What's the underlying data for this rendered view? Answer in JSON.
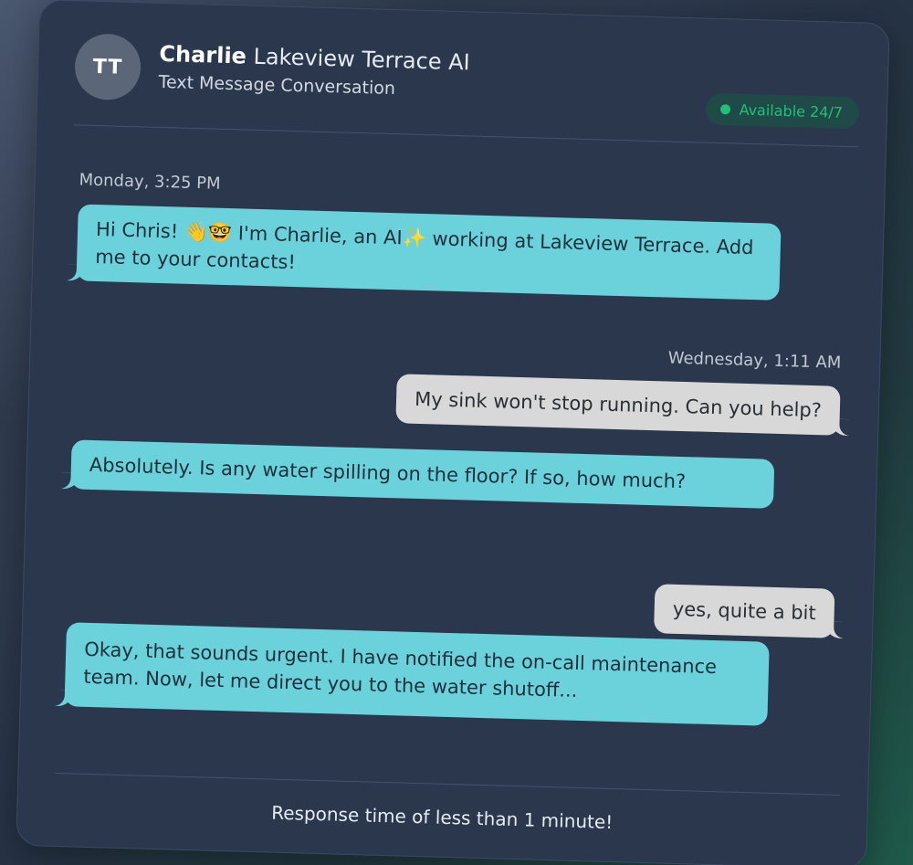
{
  "header": {
    "avatar_initials": "TT",
    "name": "Charlie",
    "title_rest": "Lakeview Terrace AI",
    "subtitle": "Text Message Conversation",
    "availability": "Available 24/7",
    "availability_color": "#20c077"
  },
  "messages": [
    {
      "type": "timestamp",
      "text": "Monday, 3:25 PM"
    },
    {
      "type": "incoming",
      "text": "Hi Chris! 👋🤓 I'm Charlie, an AI✨ working at Lakeview Terrace. Add me to your contacts!"
    },
    {
      "type": "timestamp",
      "text": "Wednesday, 1:11 AM"
    },
    {
      "type": "outgoing",
      "text": "My sink won't stop running. Can you help?"
    },
    {
      "type": "incoming",
      "text": "Absolutely. Is any water spilling on the floor? If so, how much?"
    },
    {
      "type": "outgoing",
      "text": "yes, quite a bit"
    },
    {
      "type": "incoming",
      "text": "Okay, that sounds urgent. I have notified the on-call maintenance team. Now, let me direct you to the water shutoff..."
    }
  ],
  "footer": {
    "response_time": "Response time of less than 1 minute!"
  },
  "colors": {
    "incoming_bubble": "#6bd2dc",
    "outgoing_bubble": "#d8d8d8",
    "card_background": "#2b374d"
  }
}
